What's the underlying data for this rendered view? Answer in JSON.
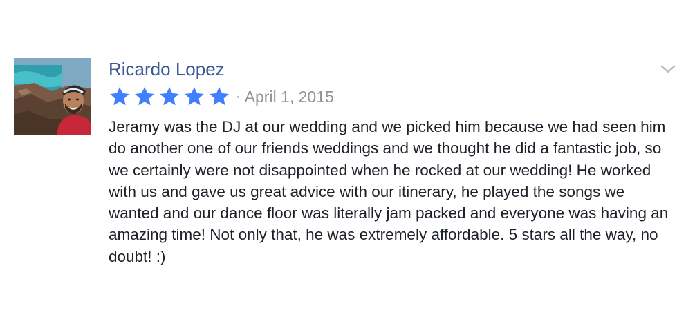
{
  "review": {
    "reviewer_name": "Ricardo Lopez",
    "avatar_icon": "profile-photo-icon",
    "rating": 5,
    "rating_max": 5,
    "star_color": "#4080ff",
    "separator": "·",
    "date": "April 1, 2015",
    "text": "Jeramy was the DJ at our wedding and we picked him because we had seen him do another one of our friends weddings and we thought he did a fantastic job, so we certainly were not disappointed when he rocked at our wedding! He worked with us and gave us great advice with our itinerary, he played the songs we wanted and our dance floor was literally jam packed and everyone was having an amazing time! Not only that, he was extremely affordable. 5 stars all the way, no doubt! :)",
    "options_icon": "chevron-down-icon"
  },
  "colors": {
    "name": "#3b5998",
    "meta": "#90949c",
    "body_text": "#1d2129"
  }
}
